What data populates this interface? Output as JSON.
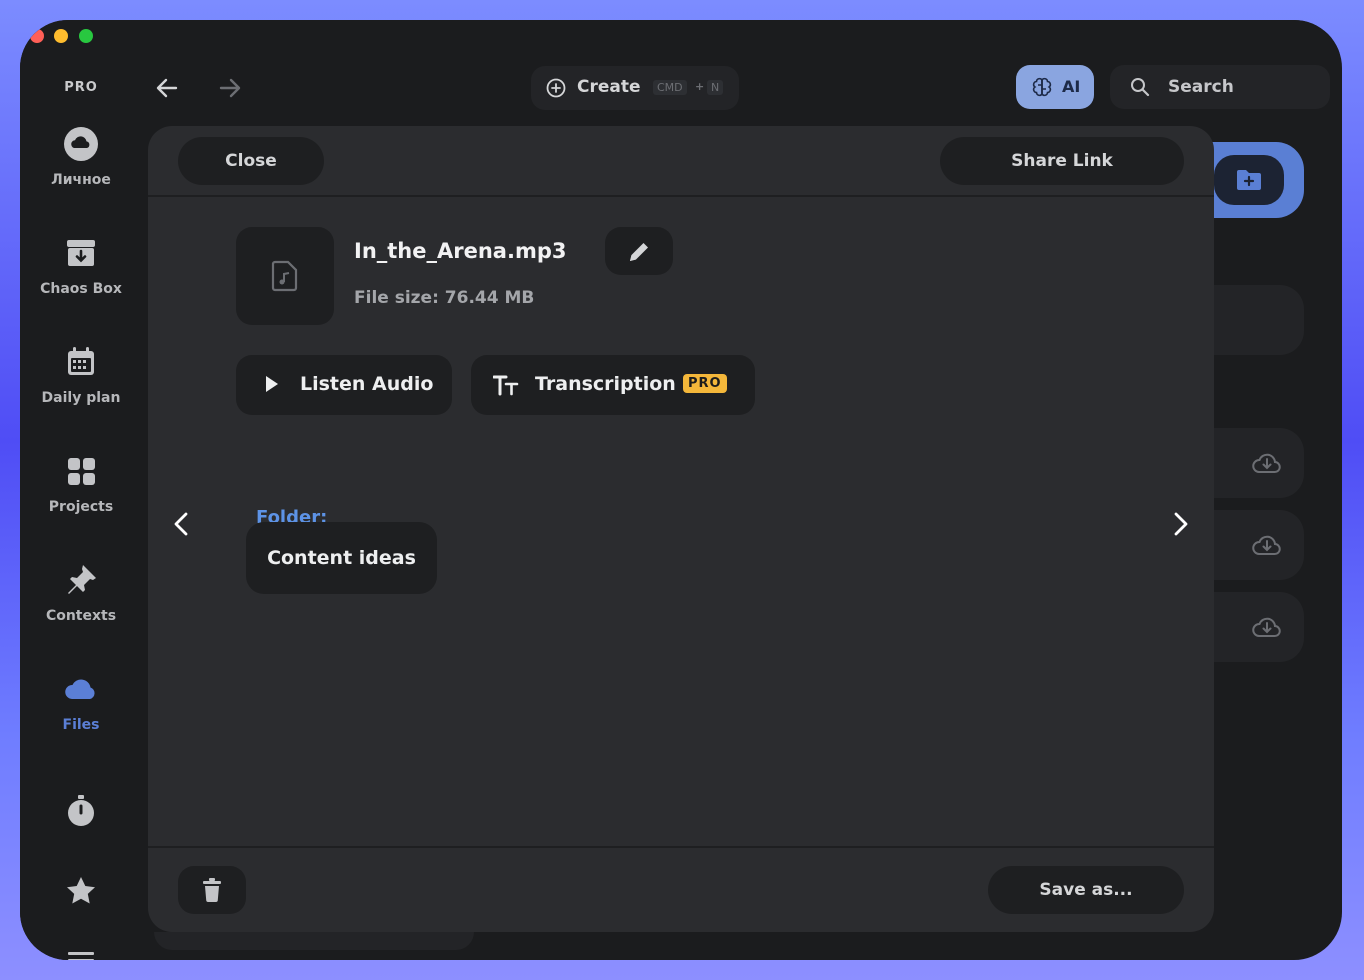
{
  "sidebar": {
    "badge": "PRO",
    "items": [
      {
        "label": "Личное",
        "icon": "cloud-circle-icon"
      },
      {
        "label": "Chaos Box",
        "icon": "inbox-download-icon"
      },
      {
        "label": "Daily plan",
        "icon": "calendar-icon"
      },
      {
        "label": "Projects",
        "icon": "grid-icon"
      },
      {
        "label": "Contexts",
        "icon": "pin-icon"
      },
      {
        "label": "Files",
        "icon": "cloud-icon",
        "active": true
      },
      {
        "label": "",
        "icon": "stopwatch-icon"
      },
      {
        "label": "",
        "icon": "star-icon"
      },
      {
        "label": "",
        "icon": "menu-icon"
      }
    ]
  },
  "topbar": {
    "create_label": "Create",
    "shortcut_key1": "CMD",
    "shortcut_plus": "+",
    "shortcut_key2": "N",
    "ai_label": "AI",
    "search_label": "Search"
  },
  "modal": {
    "close_label": "Close",
    "share_label": "Share Link",
    "file_name": "In_the_Arena.mp3",
    "file_size": "File size: 76.44 MB",
    "listen_label": "Listen Audio",
    "transcription_label": "Transcription",
    "pro_badge": "PRO",
    "folder_label": "Folder:",
    "folder_name": "Content ideas",
    "save_label": "Save as..."
  },
  "colors": {
    "accent_blue": "#5b7fd6",
    "ai_button": "#8aa5e0",
    "pro_badge": "#f4b73a",
    "folder_label": "#5d93e6",
    "window_bg": "#1b1c1e",
    "modal_bg": "#2b2c2f"
  }
}
